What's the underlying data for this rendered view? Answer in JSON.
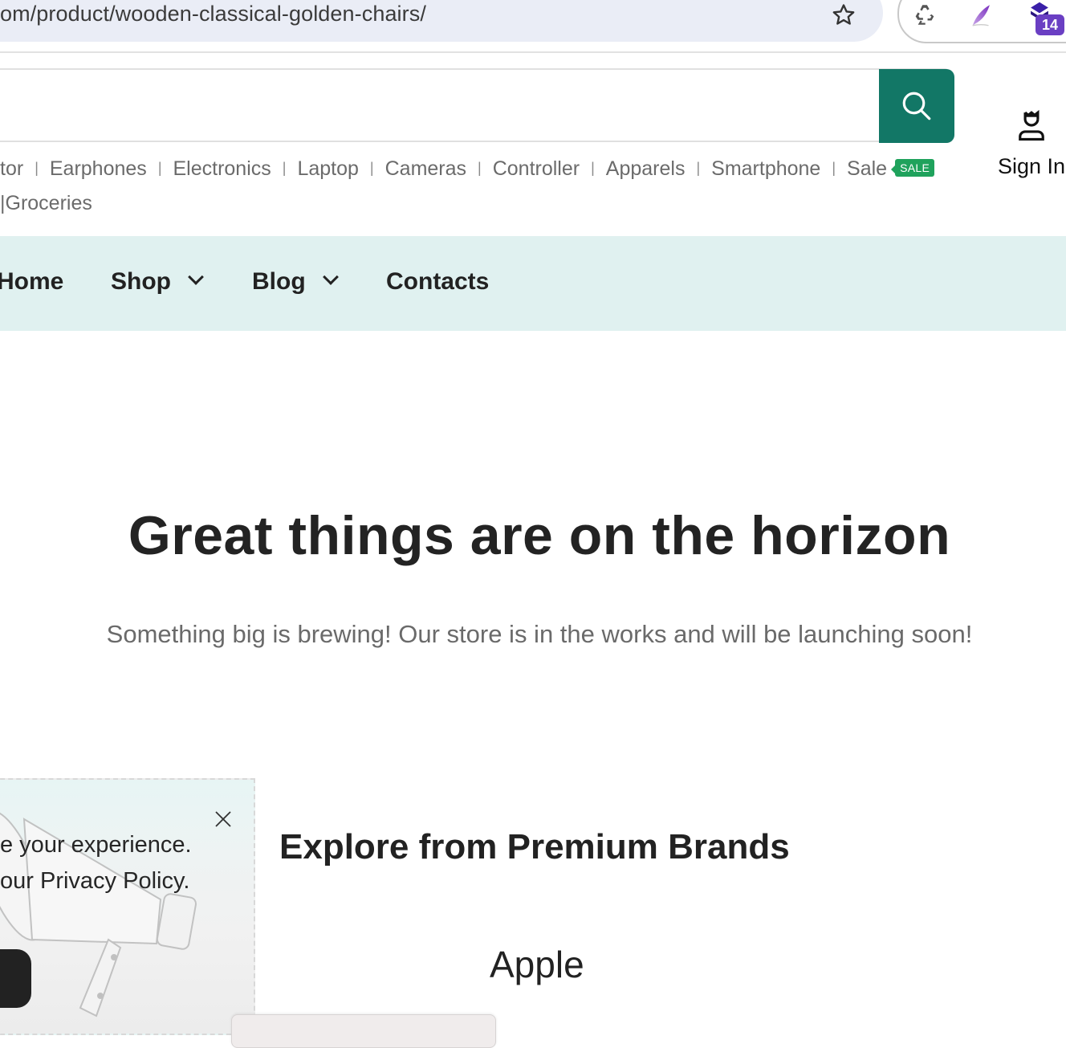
{
  "browser": {
    "url": "om/product/wooden-classical-golden-chairs/",
    "bookmark_icon": "star-icon",
    "extensions": [
      {
        "name": "recycle-extension",
        "icon": "recycle-icon"
      },
      {
        "name": "feather-extension",
        "icon": "feather-icon"
      },
      {
        "name": "stack-extension",
        "icon": "stack-icon",
        "badge": "14"
      }
    ]
  },
  "search": {
    "placeholder": "",
    "value": "",
    "button_icon": "search-icon",
    "button_color": "#127766"
  },
  "account": {
    "icon": "user-icon",
    "label": "Sign In"
  },
  "categories": {
    "row1": [
      "tor",
      "Earphones",
      "Electronics",
      "Laptop",
      "Cameras",
      "Controller",
      "Apparels",
      "Smartphone",
      "Sale"
    ],
    "sale_badge": "SALE",
    "row2": [
      "Groceries"
    ]
  },
  "nav": {
    "background": "#e0f1f0",
    "items": [
      {
        "label": "Home",
        "dropdown": false
      },
      {
        "label": "Shop",
        "dropdown": true
      },
      {
        "label": "Blog",
        "dropdown": true
      },
      {
        "label": "Contacts",
        "dropdown": false
      }
    ]
  },
  "hero": {
    "title": "Great things are on the horizon",
    "subtitle": "Something big is brewing! Our store is in the works and will be launching soon!"
  },
  "cookie_notice": {
    "line1": "e your experience.",
    "line2_prefix": "our ",
    "line2_link": "Privacy Policy",
    "line2_suffix": ".",
    "close_icon": "close-icon"
  },
  "brands": {
    "title": "Explore from Premium Brands",
    "items": [
      "Apple"
    ]
  }
}
